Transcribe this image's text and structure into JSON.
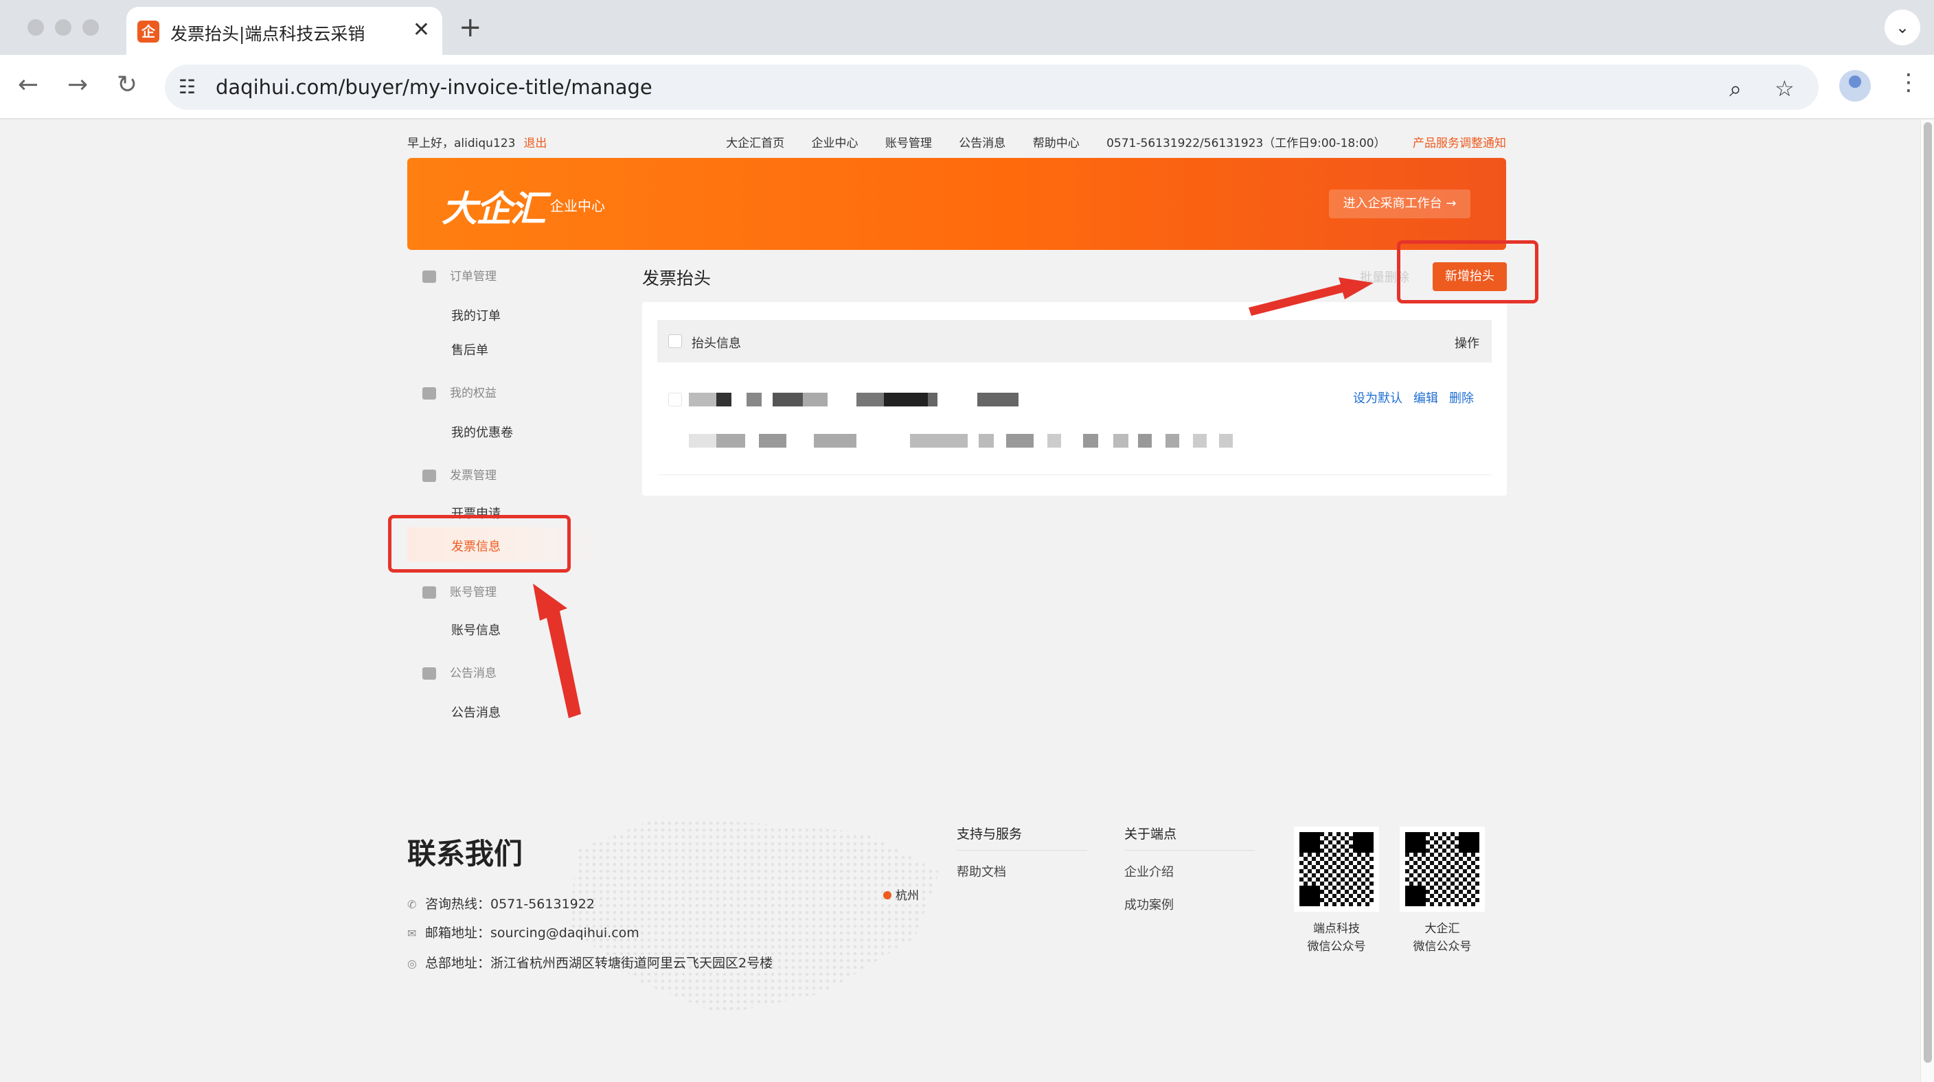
{
  "browser": {
    "tab_title": "发票抬头|端点科技云采销",
    "tab_favicon": "企",
    "close_glyph": "✕",
    "new_tab_glyph": "+",
    "url": "daqihui.com/buyer/my-invoice-title/manage",
    "icons": [
      "back-icon",
      "forward-icon",
      "reload-icon",
      "site-settings-icon",
      "zoom-icon",
      "bookmark-star-icon",
      "profile-icon",
      "more-menu-icon"
    ]
  },
  "topbar": {
    "greeting": "早上好，alidiqu123",
    "logout": "退出",
    "links": [
      "大企汇首页",
      "企业中心",
      "账号管理",
      "公告消息",
      "帮助中心"
    ],
    "phone": "0571-56131922/56131923（工作日9:00-18:00）",
    "notice": "产品服务调整通知"
  },
  "banner": {
    "brand": "大企汇",
    "subtitle": "企业中心",
    "enter_button": "进入企采商工作台 →"
  },
  "sidebar": {
    "groups": [
      {
        "label": "订单管理",
        "items": [
          "我的订单",
          "售后单"
        ]
      },
      {
        "label": "我的权益",
        "items": [
          "我的优惠卷"
        ]
      },
      {
        "label": "发票管理",
        "items": [
          "开票申请",
          "发票信息"
        ]
      },
      {
        "label": "账号管理",
        "items": [
          "账号信息"
        ]
      },
      {
        "label": "公告消息",
        "items": [
          "公告消息"
        ]
      }
    ],
    "active_item": "发票信息"
  },
  "main": {
    "title": "发票抬头",
    "batch_delete": "批量删除",
    "add_button": "新增抬头",
    "table_headers": [
      "抬头信息",
      "操作"
    ],
    "row_actions": [
      "设为默认",
      "编辑",
      "删除"
    ]
  },
  "footer": {
    "contact_title": "联系我们",
    "hotline": "咨询热线：0571-56131922",
    "email": "邮箱地址：sourcing@daqihui.com",
    "address": "总部地址：浙江省杭州西湖区转塘街道阿里云飞天园区2号楼",
    "map_city": "杭州",
    "col1_title": "支持与服务",
    "col1_links": [
      "帮助文档"
    ],
    "col2_title": "关于端点",
    "col2_links": [
      "企业介绍",
      "成功案例"
    ],
    "qr_codes": [
      {
        "caption1": "端点科技",
        "caption2": "微信公众号"
      },
      {
        "caption1": "大企汇",
        "caption2": "微信公众号"
      }
    ]
  },
  "colors": {
    "accent": "#ee5b1f",
    "link": "#1f6ed4",
    "annotation": "#e5332a"
  }
}
